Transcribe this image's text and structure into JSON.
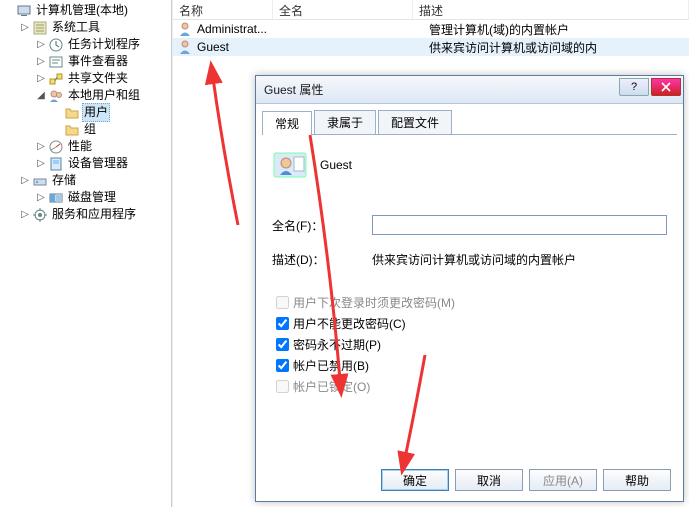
{
  "tree": {
    "root": "计算机管理(本地)",
    "items": [
      {
        "label": "系统工具",
        "icon": "tools"
      },
      {
        "label": "任务计划程序",
        "icon": "clock",
        "indent": 3
      },
      {
        "label": "事件查看器",
        "icon": "event",
        "indent": 3
      },
      {
        "label": "共享文件夹",
        "icon": "share",
        "indent": 3
      },
      {
        "label": "本地用户和组",
        "icon": "users",
        "indent": 3,
        "expanded": true
      },
      {
        "label": "用户",
        "icon": "folder",
        "indent": 4,
        "selected": true
      },
      {
        "label": "组",
        "icon": "folder",
        "indent": 4
      },
      {
        "label": "性能",
        "icon": "perf",
        "indent": 3
      },
      {
        "label": "设备管理器",
        "icon": "device",
        "indent": 3
      },
      {
        "label": "存储",
        "icon": "storage",
        "indent": 2
      },
      {
        "label": "磁盘管理",
        "icon": "disk",
        "indent": 3
      },
      {
        "label": "服务和应用程序",
        "icon": "services",
        "indent": 2
      }
    ]
  },
  "list": {
    "columns": {
      "name": "名称",
      "fullname": "全名",
      "description": "描述"
    },
    "rows": [
      {
        "name": "Administrat...",
        "fullname": "",
        "description": "管理计算机(域)的内置帐户"
      },
      {
        "name": "Guest",
        "fullname": "",
        "description": "供来宾访问计算机或访问域的内"
      }
    ]
  },
  "dialog": {
    "title": "Guest 属性",
    "tabs": [
      "常规",
      "隶属于",
      "配置文件"
    ],
    "active_tab": 0,
    "username": "Guest",
    "fullname_label": "全名(F)：",
    "fullname_value": "",
    "desc_label": "描述(D)：",
    "desc_value": "供来宾访问计算机或访问域的内置帐户",
    "checks": [
      {
        "label": "用户下次登录时须更改密码(M)",
        "checked": false,
        "disabled": true
      },
      {
        "label": "用户不能更改密码(C)",
        "checked": true
      },
      {
        "label": "密码永不过期(P)",
        "checked": true
      },
      {
        "label": "帐户已禁用(B)",
        "checked": true
      },
      {
        "label": "帐户已锁定(O)",
        "checked": false,
        "disabled": true
      }
    ],
    "buttons": {
      "ok": "确定",
      "cancel": "取消",
      "apply": "应用(A)",
      "help": "帮助"
    }
  }
}
